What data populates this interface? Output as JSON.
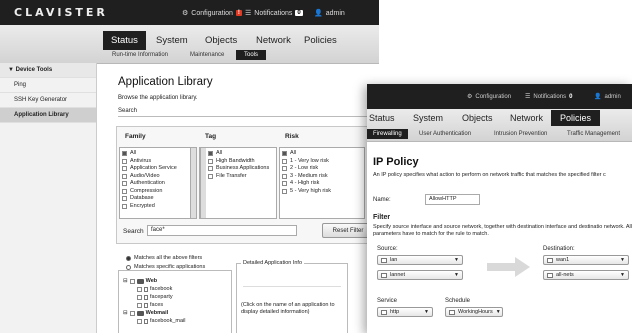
{
  "left": {
    "logo": "clavister",
    "top": {
      "config": "Configuration",
      "config_badge": "!",
      "notif": "Notifications",
      "notif_count": "0",
      "user": "admin"
    },
    "tabs": [
      "Status",
      "System",
      "Objects",
      "Network",
      "Policies"
    ],
    "subtabs": [
      "Run-time Information",
      "Maintenance",
      "Tools"
    ],
    "sidebar": {
      "header": "▼ Device Tools",
      "items": [
        "Ping",
        "SSH Key Generator",
        "Application Library"
      ]
    },
    "main": {
      "title": "Application Library",
      "desc": "Browse the application library.",
      "search_label": "Search",
      "columns": [
        "Family",
        "Tag",
        "Risk"
      ],
      "family": [
        "All",
        "Antivirus",
        "Application Service",
        "Audio/Video",
        "Authentication",
        "Compression",
        "Database",
        "Encrypted"
      ],
      "tag": [
        "All",
        "High Bandwidth",
        "Business Applications",
        "File Transfer"
      ],
      "risk": [
        "All",
        "1 - Very low risk",
        "2 - Low risk",
        "3 - Medium risk",
        "4 - High risk",
        "5 - Very high risk"
      ],
      "search_field_label": "Search",
      "search_value": "face*",
      "reset_button": "Reset Filter",
      "radio1": "Matches all the above filters",
      "radio2": "Matches specific applications",
      "tree": [
        {
          "label": "Web",
          "type": "folder"
        },
        {
          "label": "facebook",
          "type": "doc"
        },
        {
          "label": "faceparty",
          "type": "doc"
        },
        {
          "label": "faces",
          "type": "doc"
        },
        {
          "label": "Webmail",
          "type": "folder"
        },
        {
          "label": "facebook_mail",
          "type": "doc"
        }
      ],
      "detail_title": "Detailed Application Info",
      "detail_hint": "(Click on the name of an application to display detailed information)"
    }
  },
  "right": {
    "top": {
      "config": "Configuration",
      "notif": "Notifications",
      "notif_count": "0",
      "user": "admin"
    },
    "tabs": [
      "Status",
      "System",
      "Objects",
      "Network",
      "Policies"
    ],
    "subtabs": [
      "Firewalling",
      "User Authentication",
      "Intrusion Prevention",
      "Traffic Management"
    ],
    "title": "IP Policy",
    "desc": "An IP policy specifies what action to perform on network traffic that matches the specified filter c",
    "name_label": "Name:",
    "name_value": "AllowHTTP",
    "filter_title": "Filter",
    "filter_desc": "Specify source interface and source network, together with destination interface and destinatio network. All parameters have to match for the rule to match.",
    "source_label": "Source:",
    "dest_label": "Destination:",
    "source_if": "lan",
    "source_net": "lannet",
    "dest_if": "wan1",
    "dest_net": "all-nets",
    "service_label": "Service",
    "service_value": "http",
    "schedule_label": "Schedule",
    "schedule_value": "WorkingHours"
  }
}
